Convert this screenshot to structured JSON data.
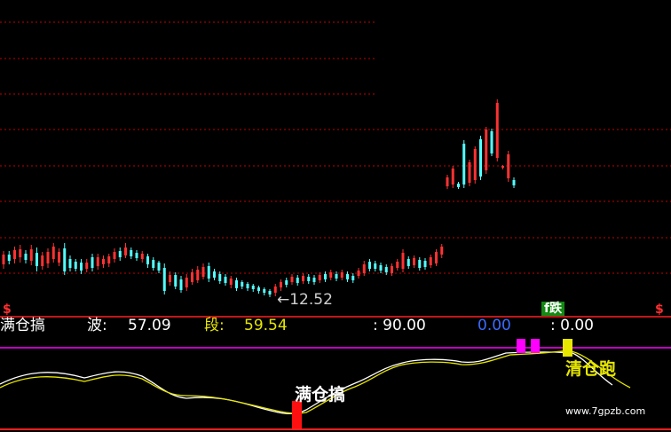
{
  "price_panel": {
    "min_price_label": "←12.52",
    "badge": "f跌"
  },
  "indicator_panel": {
    "name": "满仓搞",
    "bo_label": "波:",
    "bo_value": "57.09",
    "duan_label": "段:",
    "duan_value": "59.54",
    "level_text": ": 90.00",
    "blue_value": "0.00",
    "last_value": ": 0.00",
    "signal_buy": "满仓搞",
    "signal_sell": "清仓跑"
  },
  "watermark": "www.7gpzb.com",
  "colors": {
    "up": "#ff3232",
    "down": "#54ffff",
    "grid": "#c80000",
    "white_line": "#ffffff",
    "yellow_line": "#e6e600",
    "magenta": "#ff00ff",
    "blue": "#3c6cff"
  },
  "chart_data": {
    "type": "candlestick",
    "candles": [
      [
        "up",
        283,
        303,
        287,
        298
      ],
      [
        "down",
        283,
        298,
        287,
        294
      ],
      [
        "up",
        278,
        297,
        282,
        292
      ],
      [
        "up",
        276,
        296,
        281,
        290
      ],
      [
        "down",
        282,
        297,
        286,
        293
      ],
      [
        "up",
        276,
        299,
        281,
        294
      ],
      [
        "down",
        279,
        306,
        285,
        300
      ],
      [
        "up",
        284,
        304,
        288,
        300
      ],
      [
        "up",
        280,
        302,
        284,
        297
      ],
      [
        "up",
        274,
        296,
        278,
        292
      ],
      [
        "up",
        280,
        300,
        284,
        296
      ],
      [
        "down",
        274,
        310,
        280,
        306
      ],
      [
        "down",
        288,
        306,
        292,
        302
      ],
      [
        "down",
        292,
        306,
        295,
        303
      ],
      [
        "down",
        292,
        309,
        296,
        305
      ],
      [
        "up",
        292,
        307,
        296,
        303
      ],
      [
        "down",
        286,
        306,
        290,
        302
      ],
      [
        "up",
        286,
        304,
        290,
        300
      ],
      [
        "up",
        288,
        302,
        292,
        298
      ],
      [
        "up",
        286,
        301,
        289,
        297
      ],
      [
        "up",
        280,
        296,
        284,
        292
      ],
      [
        "down",
        279,
        294,
        283,
        290
      ],
      [
        "up",
        274,
        291,
        279,
        288
      ],
      [
        "down",
        279,
        292,
        282,
        289
      ],
      [
        "down",
        282,
        294,
        285,
        291
      ],
      [
        "up",
        283,
        296,
        286,
        292
      ],
      [
        "down",
        286,
        302,
        289,
        298
      ],
      [
        "down",
        290,
        305,
        293,
        302
      ],
      [
        "down",
        294,
        308,
        296,
        305
      ],
      [
        "down",
        297,
        332,
        302,
        328
      ],
      [
        "up",
        306,
        322,
        310,
        318
      ],
      [
        "down",
        307,
        326,
        310,
        323
      ],
      [
        "down",
        311,
        330,
        315,
        327
      ],
      [
        "up",
        309,
        328,
        313,
        324
      ],
      [
        "up",
        303,
        321,
        307,
        318
      ],
      [
        "up",
        300,
        319,
        304,
        316
      ],
      [
        "up",
        297,
        315,
        301,
        312
      ],
      [
        "down",
        296,
        318,
        300,
        314
      ],
      [
        "down",
        303,
        316,
        306,
        313
      ],
      [
        "down",
        306,
        320,
        309,
        317
      ],
      [
        "down",
        309,
        322,
        312,
        319
      ],
      [
        "up",
        311,
        325,
        314,
        321
      ],
      [
        "down",
        313,
        328,
        316,
        325
      ],
      [
        "down",
        316,
        326,
        318,
        323
      ],
      [
        "down",
        318,
        328,
        320,
        325
      ],
      [
        "down",
        320,
        329,
        322,
        326
      ],
      [
        "down",
        322,
        331,
        324,
        328
      ],
      [
        "down",
        324,
        333,
        326,
        330
      ],
      [
        "down",
        326,
        335,
        328,
        332
      ],
      [
        "up",
        320,
        334,
        323,
        330
      ],
      [
        "up",
        315,
        328,
        318,
        324
      ],
      [
        "down",
        313,
        324,
        316,
        321
      ],
      [
        "up",
        309,
        321,
        312,
        318
      ],
      [
        "down",
        310,
        322,
        313,
        319
      ],
      [
        "up",
        308,
        320,
        311,
        317
      ],
      [
        "down",
        309,
        320,
        312,
        317
      ],
      [
        "down",
        310,
        321,
        313,
        318
      ],
      [
        "up",
        307,
        319,
        310,
        316
      ],
      [
        "down",
        306,
        318,
        309,
        315
      ],
      [
        "up",
        304,
        316,
        307,
        313
      ],
      [
        "down",
        306,
        317,
        309,
        314
      ],
      [
        "up",
        304,
        316,
        307,
        313
      ],
      [
        "down",
        306,
        318,
        309,
        315
      ],
      [
        "down",
        308,
        319,
        311,
        316
      ],
      [
        "up",
        302,
        314,
        305,
        311
      ],
      [
        "up",
        294,
        311,
        298,
        308
      ],
      [
        "down",
        292,
        306,
        295,
        303
      ],
      [
        "down",
        294,
        306,
        297,
        303
      ],
      [
        "down",
        296,
        308,
        299,
        305
      ],
      [
        "down",
        298,
        310,
        301,
        307
      ],
      [
        "up",
        297,
        311,
        300,
        308
      ],
      [
        "up",
        292,
        305,
        295,
        302
      ],
      [
        "up",
        281,
        307,
        285,
        303
      ],
      [
        "down",
        289,
        303,
        292,
        300
      ],
      [
        "up",
        288,
        302,
        291,
        299
      ],
      [
        "down",
        290,
        305,
        293,
        302
      ],
      [
        "down",
        291,
        304,
        294,
        301
      ],
      [
        "up",
        287,
        302,
        290,
        299
      ],
      [
        "up",
        281,
        300,
        284,
        297
      ],
      [
        "up",
        275,
        291,
        278,
        287
      ],
      [
        "up",
        197,
        213,
        200,
        210
      ],
      [
        "up",
        187,
        212,
        190,
        208
      ],
      [
        "down",
        205,
        213,
        207,
        211
      ],
      [
        "down",
        158,
        212,
        162,
        208
      ],
      [
        "up",
        180,
        210,
        183,
        206
      ],
      [
        "up",
        165,
        207,
        168,
        203
      ],
      [
        "down",
        153,
        203,
        157,
        199
      ],
      [
        "up",
        143,
        196,
        146,
        192
      ],
      [
        "down",
        145,
        176,
        148,
        173
      ],
      [
        "up",
        112,
        182,
        116,
        178
      ],
      [
        "up",
        186,
        191,
        187,
        189
      ],
      [
        "up",
        170,
        205,
        174,
        201
      ],
      [
        "down",
        200,
        212,
        203,
        209
      ]
    ]
  }
}
